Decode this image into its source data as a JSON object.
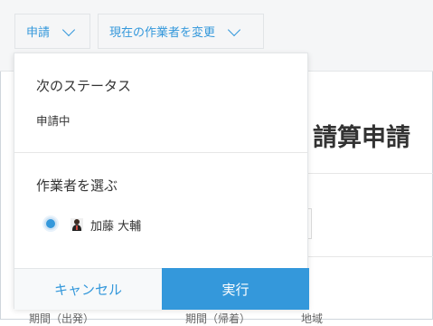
{
  "topbar": {
    "apply_label": "申請",
    "change_assignee_label": "現在の作業者を変更"
  },
  "background": {
    "title_fragment": "請算申請",
    "footer_labels": [
      "期間（出発）",
      "期間（帰着）",
      "地域"
    ]
  },
  "panel": {
    "next_status_heading": "次のステータス",
    "next_status_value": "申請中",
    "choose_assignee_heading": "作業者を選ぶ",
    "assignee_name": "加藤 大輔",
    "cancel_label": "キャンセル",
    "run_label": "実行"
  },
  "colors": {
    "accent": "#3498db",
    "background_bar": "#f5f6f7"
  }
}
